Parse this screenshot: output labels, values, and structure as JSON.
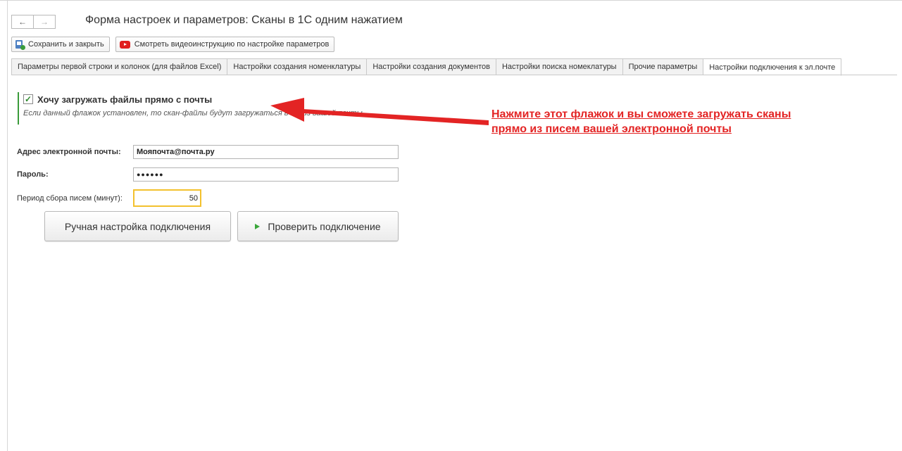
{
  "window": {
    "title": "Форма настроек и параметров: Сканы в 1С одним нажатием",
    "nav": {
      "back_icon": "←",
      "forward_icon": "→"
    }
  },
  "toolbar": {
    "save_close_label": "Сохранить и закрыть",
    "video_label": "Смотреть видеоинструкцию по настройке параметров"
  },
  "tabs": [
    {
      "label": "Параметры первой строки и колонок (для файлов Excel)",
      "active": false
    },
    {
      "label": "Настройки создания номенклатуры",
      "active": false
    },
    {
      "label": "Настройки создания документов",
      "active": false
    },
    {
      "label": "Настройки поиска номекла­туры",
      "active": false
    },
    {
      "label": "Прочие параметры",
      "active": false
    },
    {
      "label": "Настройки подключения к эл.почте",
      "active": true
    }
  ],
  "email_group": {
    "checkbox_label": "Хочу загружать файлы прямо с почты",
    "checked": true,
    "checkmark": "✓",
    "hint": "Если данный флажок установлен, то скан-файлы будут загружаться в 1С из вашей почты"
  },
  "fields": {
    "email_label": "Адрес электронной почты:",
    "email_value": "Мояпочта@почта.ру",
    "password_label": "Пароль:",
    "password_value": "●●●●●●",
    "period_label": "Период сбора писем (минут):",
    "period_value": "50"
  },
  "buttons": {
    "manual_setup": "Ручная настройка подключения",
    "check_connection": "Проверить подключение"
  },
  "annotation": {
    "line1": "Нажмите этот флажок и вы сможете загружать сканы",
    "line2": "прямо из писем вашей электронной почты"
  },
  "colors": {
    "accent_green": "#3a9b3a",
    "annotation_red": "#e32424",
    "focus_yellow": "#f3c12e"
  }
}
